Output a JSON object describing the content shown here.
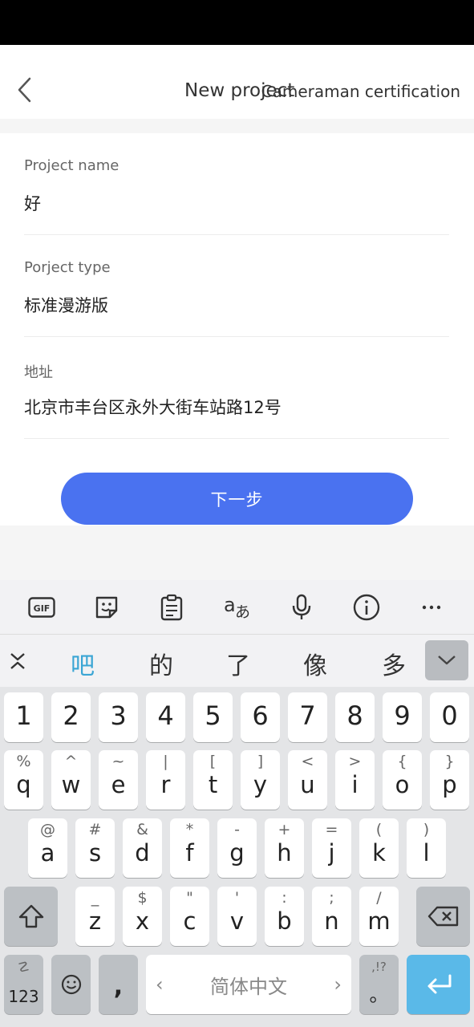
{
  "header": {
    "title": "New project",
    "right_action": "Cameraman certification"
  },
  "form": {
    "fields": [
      {
        "label": "Project name",
        "value": "好"
      },
      {
        "label": "Porject type",
        "value": "标准漫游版"
      },
      {
        "label": "地址",
        "value": "北京市丰台区永外大街车站路12号"
      }
    ],
    "next_button": "下一步"
  },
  "keyboard": {
    "toolbar": [
      "gif-icon",
      "sticker-icon",
      "clipboard-icon",
      "translate-icon",
      "microphone-icon",
      "info-icon",
      "more-icon"
    ],
    "candidates": [
      "吧",
      "的",
      "了",
      "像",
      "多"
    ],
    "number_row": [
      "1",
      "2",
      "3",
      "4",
      "5",
      "6",
      "7",
      "8",
      "9",
      "0"
    ],
    "row1": [
      {
        "sub": "%",
        "main": "q"
      },
      {
        "sub": "^",
        "main": "w"
      },
      {
        "sub": "~",
        "main": "e"
      },
      {
        "sub": "|",
        "main": "r"
      },
      {
        "sub": "[",
        "main": "t"
      },
      {
        "sub": "]",
        "main": "y"
      },
      {
        "sub": "<",
        "main": "u"
      },
      {
        "sub": ">",
        "main": "i"
      },
      {
        "sub": "{",
        "main": "o"
      },
      {
        "sub": "}",
        "main": "p"
      }
    ],
    "row2": [
      {
        "sub": "@",
        "main": "a"
      },
      {
        "sub": "#",
        "main": "s"
      },
      {
        "sub": "&",
        "main": "d"
      },
      {
        "sub": "*",
        "main": "f"
      },
      {
        "sub": "-",
        "main": "g"
      },
      {
        "sub": "+",
        "main": "h"
      },
      {
        "sub": "=",
        "main": "j"
      },
      {
        "sub": "(",
        "main": "k"
      },
      {
        "sub": ")",
        "main": "l"
      }
    ],
    "row3": [
      {
        "sub": "_",
        "main": "z"
      },
      {
        "sub": "$",
        "main": "x"
      },
      {
        "sub": "\"",
        "main": "c"
      },
      {
        "sub": "'",
        "main": "v"
      },
      {
        "sub": ":",
        "main": "b"
      },
      {
        "sub": ";",
        "main": "n"
      },
      {
        "sub": "/",
        "main": "m"
      }
    ],
    "symbols_key": "123",
    "symbols_key_sub": "☡",
    "comma_key": ",",
    "space_label": "简体中文",
    "space_left": "‹",
    "space_right": "›",
    "period_key": "。",
    "period_key_sub": ",!?"
  }
}
